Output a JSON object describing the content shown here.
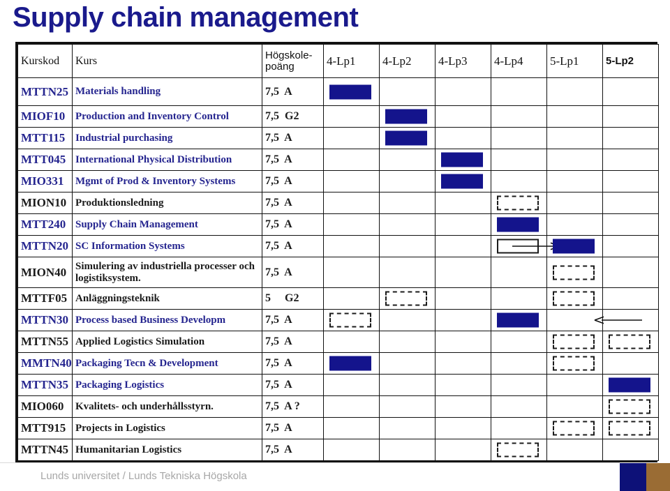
{
  "slide": {
    "title": "Supply chain management"
  },
  "footer": {
    "text": "Lunds universitet / Lunds Tekniska Högskola",
    "logo_navy_color": "#0d1178",
    "logo_brown_color": "#9a6c34"
  },
  "colors": {
    "title": "#1a1a8c",
    "code_navy": "#25258f",
    "code_black": "#1b1b1b",
    "mark_filled": "#14148c",
    "table_border": "#111111"
  },
  "table": {
    "headers": {
      "code": "Kurskod",
      "name": "Kurs",
      "points": "Högskole-\npoäng",
      "points_line1": "Högskole-",
      "points_line2": "poäng",
      "periods": [
        "4-Lp1",
        "4-Lp2",
        "4-Lp3",
        "4-Lp4",
        "5-Lp1",
        "5-Lp2"
      ]
    },
    "legend": {
      "filled": "offered / scheduled block",
      "dashed": "tentative block",
      "outline": "moved-from block"
    },
    "rows": [
      {
        "code": "MTTN25",
        "code_color": "navy",
        "name": "Materials handling",
        "name_color": "navy",
        "points": "7,5  A",
        "marks": [
          "filled",
          "",
          "",
          "",
          "",
          ""
        ]
      },
      {
        "code": "MIOF10",
        "code_color": "navy",
        "name": "Production and Inventory  Control",
        "name_color": "navy",
        "points": "7,5  G2",
        "marks": [
          "",
          "filled",
          "",
          "",
          "",
          ""
        ]
      },
      {
        "code": "MTT115",
        "code_color": "navy",
        "name": "Industrial purchasing",
        "name_color": "navy",
        "points": "7,5  A",
        "marks": [
          "",
          "filled",
          "",
          "",
          "",
          ""
        ]
      },
      {
        "code": "MTT045",
        "code_color": "navy",
        "name": "International Physical Distribution",
        "name_color": "navy",
        "points": "7,5  A",
        "marks": [
          "",
          "",
          "filled",
          "",
          "",
          ""
        ]
      },
      {
        "code": "MIO331",
        "code_color": "navy",
        "name": "Mgmt of Prod & Inventory Systems",
        "name_color": "navy",
        "points": "7,5  A",
        "marks": [
          "",
          "",
          "filled",
          "",
          "",
          ""
        ]
      },
      {
        "code": "MION10",
        "code_color": "black",
        "name": "Produktionsledning",
        "name_color": "black",
        "points": "7,5  A",
        "marks": [
          "",
          "",
          "",
          "dashed",
          "",
          ""
        ]
      },
      {
        "code": "MTT240",
        "code_color": "navy",
        "name": "Supply Chain Management",
        "name_color": "navy",
        "points": "7,5  A",
        "marks": [
          "",
          "",
          "",
          "filled",
          "",
          ""
        ]
      },
      {
        "code": "MTTN20",
        "code_color": "navy",
        "name": "SC Information Systems",
        "name_color": "navy",
        "points": "7,5  A",
        "marks": [
          "",
          "",
          "",
          "outline",
          "filled",
          ""
        ],
        "arrow": {
          "from_col": 3,
          "to_col": 4,
          "direction": "right"
        }
      },
      {
        "code": "MION40",
        "code_color": "black",
        "name": "Simulering av industriella processer och logistiksystem.",
        "name_color": "black",
        "points": "7,5  A",
        "marks": [
          "",
          "",
          "",
          "",
          "dashed",
          ""
        ]
      },
      {
        "code": "MTTF05",
        "code_color": "black",
        "name": "Anläggningsteknik",
        "name_color": "black",
        "points": "5     G2",
        "marks": [
          "",
          "dashed",
          "",
          "",
          "dashed",
          ""
        ]
      },
      {
        "code": "MTTN30",
        "code_color": "navy",
        "name": "Process based Business Developm",
        "name_color": "navy",
        "points": "7,5  A",
        "marks": [
          "dashed",
          "",
          "",
          "filled",
          "",
          ""
        ],
        "arrow": {
          "from_col": 4,
          "to_col": 3,
          "direction": "left"
        }
      },
      {
        "code": "MTTN55",
        "code_color": "black",
        "name": "Applied Logistics Simulation",
        "name_color": "black",
        "points": "7,5  A",
        "marks": [
          "",
          "",
          "",
          "",
          "dashed",
          "dashed"
        ]
      },
      {
        "code": "MMTN40",
        "code_color": "navy",
        "name": "Packaging Tecn & Development",
        "name_color": "navy",
        "points": "7,5  A",
        "marks": [
          "filled",
          "",
          "",
          "",
          "dashed",
          ""
        ]
      },
      {
        "code": "MTTN35",
        "code_color": "navy",
        "name": "Packaging Logistics",
        "name_color": "navy",
        "points": "7,5  A",
        "marks": [
          "",
          "",
          "",
          "",
          "",
          "filled"
        ]
      },
      {
        "code": "MIO060",
        "code_color": "black",
        "name": "Kvalitets- och underhållsstyrn.",
        "name_color": "black",
        "points": "7,5  A ?",
        "marks": [
          "",
          "",
          "",
          "",
          "",
          "dashed"
        ]
      },
      {
        "code": "MTT915",
        "code_color": "black",
        "name": "Projects in Logistics",
        "name_color": "black",
        "points": "7,5  A",
        "marks": [
          "",
          "",
          "",
          "",
          "dashed",
          "dashed"
        ]
      },
      {
        "code": "MTTN45",
        "code_color": "black",
        "name": "Humanitarian Logistics",
        "name_color": "black",
        "points": "7,5  A",
        "marks": [
          "",
          "",
          "",
          "dashed",
          "",
          ""
        ]
      }
    ]
  }
}
